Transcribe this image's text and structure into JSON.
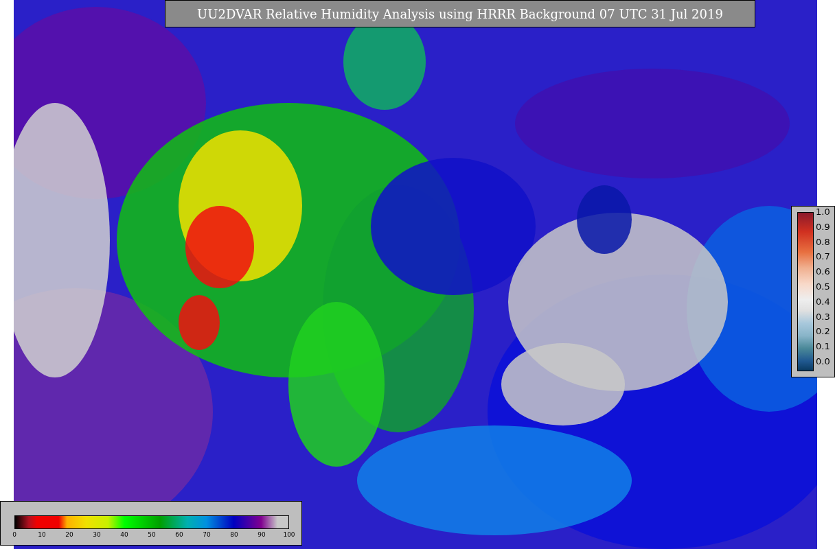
{
  "title": "UU2DVAR Relative Humidity Analysis using HRRR Background 07 UTC 31 Jul 2019",
  "humidity_colorbar": {
    "ticks": [
      "0",
      "10",
      "20",
      "30",
      "40",
      "50",
      "60",
      "70",
      "80",
      "90",
      "100"
    ]
  },
  "ratio_colorbar": {
    "ticks": [
      "1.0",
      "0.9",
      "0.8",
      "0.7",
      "0.6",
      "0.5",
      "0.4",
      "0.3",
      "0.2",
      "0.1",
      "0.0"
    ]
  }
}
